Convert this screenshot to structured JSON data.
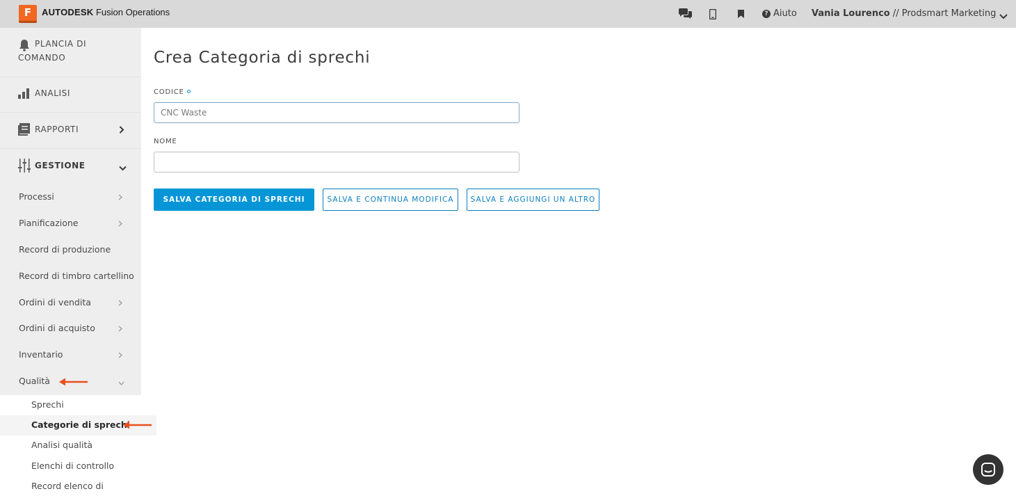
{
  "topbar": {
    "logo_letter": "F",
    "brand_bold": "AUTODESK",
    "brand_rest": "Fusion Operations",
    "icons": [
      "chat-icon",
      "mobile-icon",
      "bookmark-icon",
      "help-icon"
    ],
    "help_label": "Aiuto",
    "user_name": "Vania Lourenco",
    "user_sep": " // ",
    "company": "Prodsmart Marketing"
  },
  "sidebar": {
    "top_items": [
      {
        "label_line1": "PLANCIA DI",
        "label_line2": "COMANDO",
        "icon": "bell-icon"
      },
      {
        "label": "ANALISI",
        "icon": "bar-chart-icon"
      },
      {
        "label": "RAPPORTI",
        "icon": "report-icon"
      },
      {
        "label": "GESTIONE",
        "icon": "sliders-icon"
      }
    ],
    "sub_items": [
      {
        "label": "Processi"
      },
      {
        "label": "Pianificazione"
      },
      {
        "label": "Record di produzione"
      },
      {
        "label": "Record di timbro cartellino"
      },
      {
        "label": "Ordini di vendita"
      },
      {
        "label": "Ordini di acquisto"
      },
      {
        "label": "Inventario"
      },
      {
        "label": "Qualità"
      }
    ],
    "quality_children": [
      {
        "label": "Sprechi"
      },
      {
        "label": "Categorie di sprechi"
      },
      {
        "label": "Analisi qualità"
      },
      {
        "label": "Elenchi di controllo"
      },
      {
        "label": "Record elenco di"
      }
    ],
    "active_child": "Categorie di sprechi"
  },
  "main": {
    "title": "Crea Categoria di sprechi",
    "code_label": "CODICE",
    "code_placeholder": "CNC Waste",
    "name_label": "NOME",
    "name_value": "",
    "save_button": "SALVA CATEGORIA DI SPRECHI",
    "save_continue_button": "SALVA E CONTINUA MODIFICA",
    "save_add_button": "SALVA E AGGIUNGI UN ALTRO"
  },
  "colors": {
    "accent": "#0696d7",
    "logo": "#f26722",
    "annotation_arrow": "#e8501e",
    "topbar": "#d9d9d9",
    "sidebar": "#eeeeee"
  }
}
